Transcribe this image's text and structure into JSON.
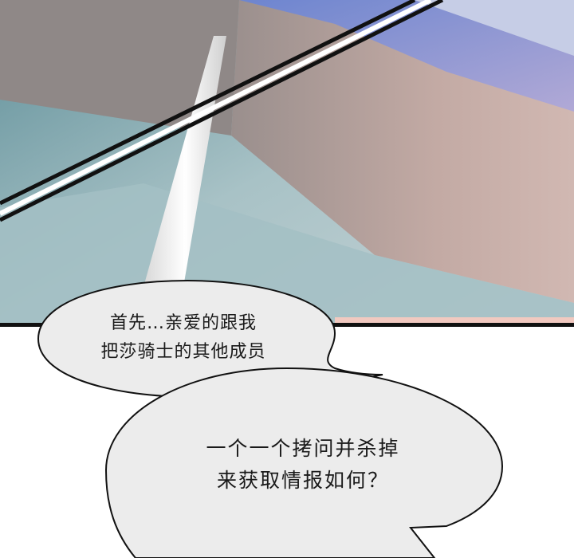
{
  "bubbles": [
    {
      "lines": [
        "首先…亲爱的跟我",
        "把莎骑士的其他成员"
      ]
    },
    {
      "lines": [
        "一个一个拷问并杀掉",
        "来获取情报如何？"
      ]
    }
  ],
  "colors": {
    "wall_dark": "#8e8888",
    "wall_light": "#c9b3ad",
    "sky_blue": "#7f95d8",
    "water_teal": "#8fb3b8",
    "ink": "#111111"
  }
}
